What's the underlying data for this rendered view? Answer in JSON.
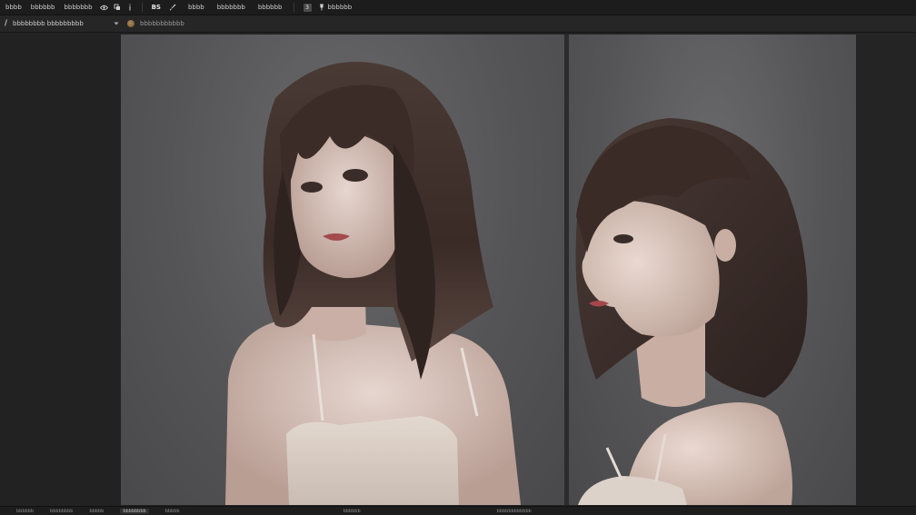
{
  "menubar": {
    "items": [
      "bbbb",
      "bbbbbb",
      "bbbbbbb"
    ],
    "icon1": "eye-icon",
    "icon2": "overlay-icon",
    "icon3": "info-icon",
    "logo": "BS",
    "icon4": "brush-icon",
    "items2": [
      "bbbb",
      "bbbbbbb",
      "bbbbbb"
    ],
    "badge": "3",
    "pin_label": "bbbbbb"
  },
  "toolbar": {
    "tool_label": "bbbbbbbb bbbbbbbbb",
    "file_label": "bbbbbbbbbbb"
  },
  "statusbar": {
    "items": [
      "bbbbbb",
      "bbbbbbbb",
      "bbbbb",
      "bbbbbbbb",
      "bbbbb",
      "bbbbbb",
      "bbbbbbbbbbbb"
    ]
  },
  "colors": {
    "chrome": "#1c1c1c",
    "canvas_bg": "#555557",
    "panel": "#222222"
  }
}
